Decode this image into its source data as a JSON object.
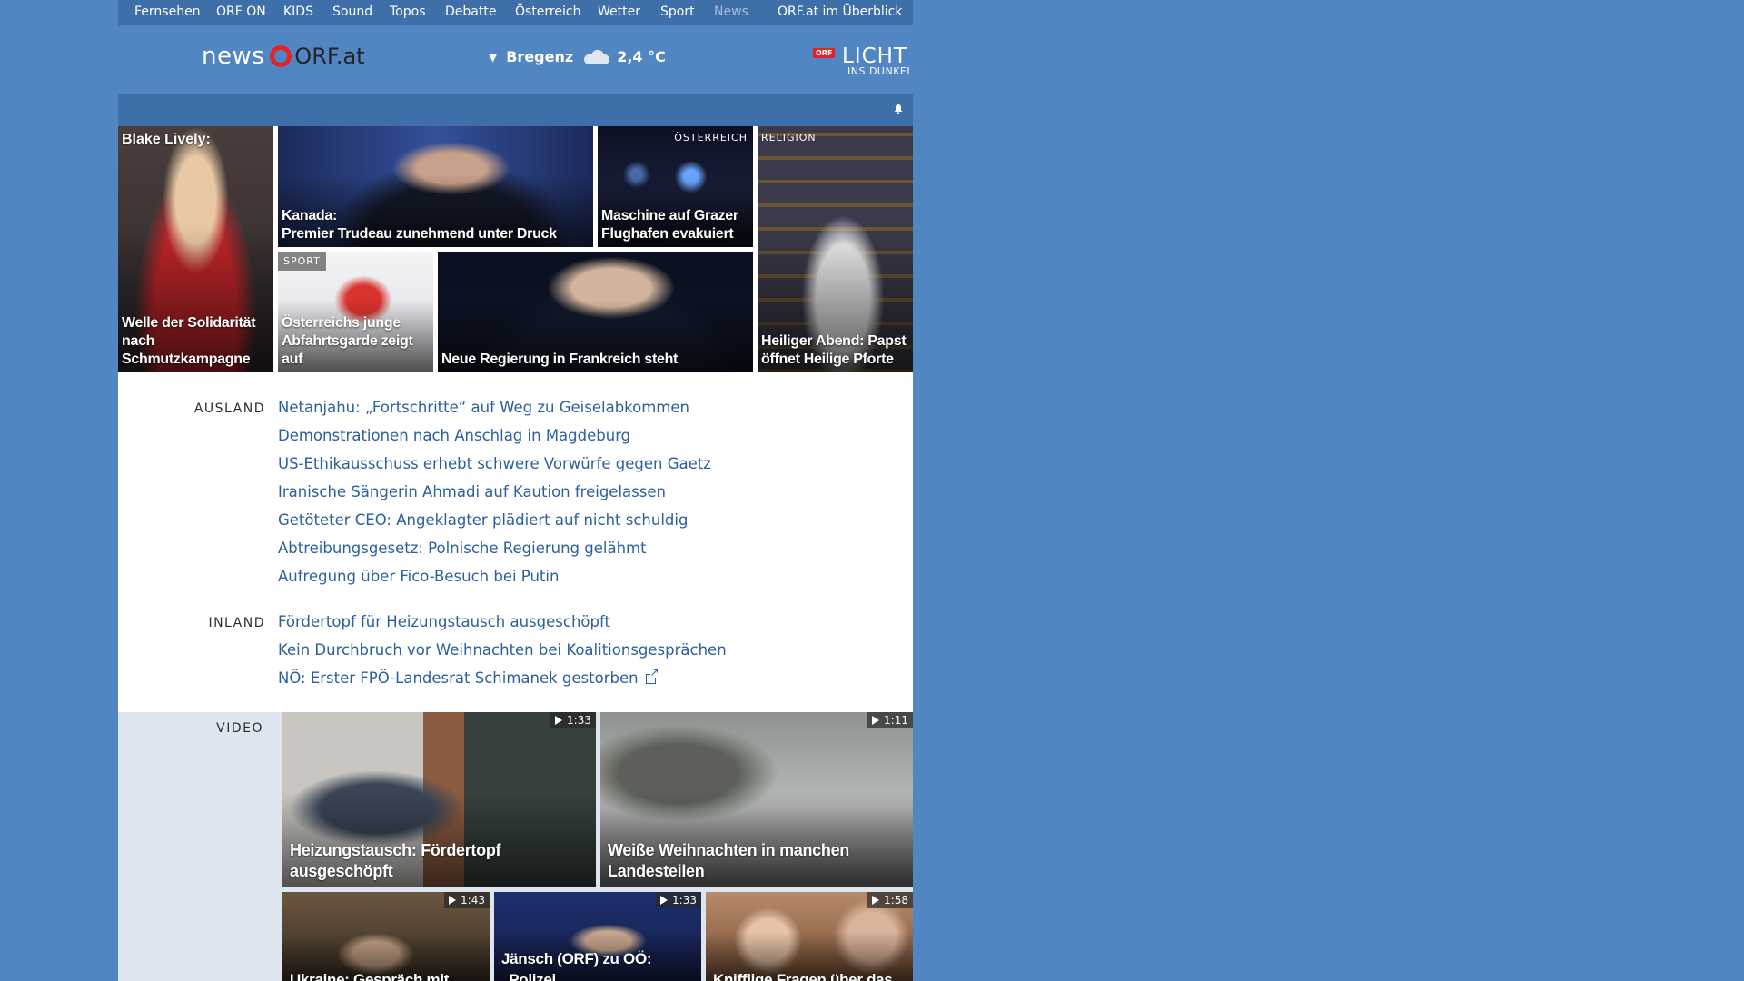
{
  "topnav": {
    "items": [
      "Fernsehen",
      "ORF ON",
      "KIDS",
      "Sound",
      "Topos",
      "Debatte",
      "Österreich",
      "Wetter",
      "Sport",
      "News"
    ],
    "overview": "ORF.at im Überblick"
  },
  "header": {
    "logo_news": "news",
    "logo_orf": "ORF.at",
    "weather_city": "Bregenz",
    "weather_temp": "2,4 °C",
    "weather_icon": "cloud-icon",
    "licht_badge": "ORF",
    "licht_big": "LICHT",
    "licht_small": "INS DUNKEL"
  },
  "teasers": [
    {
      "top": "Blake Lively:",
      "caption": "Welle der Solidarität nach Schmutzkampagne"
    },
    {
      "caption_line1": "Kanada:",
      "caption_line2": "Premier Trudeau zunehmend unter Druck"
    },
    {
      "label": "ÖSTERREICH",
      "caption": "Maschine auf Grazer Flughafen evakuiert"
    },
    {
      "label": "RELIGION",
      "caption": "Heiliger Abend: Papst öffnet Heilige Pforte"
    },
    {
      "label": "SPORT",
      "caption": "Österreichs junge Abfahrtsgarde zeigt auf"
    },
    {
      "caption": "Neue Regierung in Frankreich steht"
    }
  ],
  "ausland": {
    "title": "AUSLAND",
    "links": [
      "Netanjahu: „Fortschritte“ auf Weg zu Geiselabkommen",
      "Demonstrationen nach Anschlag in Magdeburg",
      "US-Ethikausschuss erhebt schwere Vorwürfe gegen Gaetz",
      "Iranische Sängerin Ahmadi auf Kaution freigelassen",
      "Getöteter CEO: Angeklagter plädiert auf nicht schuldig",
      "Abtreibungsgesetz: Polnische Regierung gelähmt",
      "Aufregung über Fico-Besuch bei Putin"
    ]
  },
  "inland": {
    "title": "INLAND",
    "links": [
      "Fördertopf für Heizungstausch ausgeschöpft",
      "Kein Durchbruch vor Weihnachten bei Koalitionsgesprächen",
      "NÖ: Erster FPÖ-Landesrat Schimanek gestorben"
    ]
  },
  "video": {
    "title": "VIDEO",
    "items": [
      {
        "caption": "Heizungstausch: Fördertopf ausgeschöpft",
        "duration": "1:33"
      },
      {
        "caption": "Weiße Weihnachten in manchen Landesteilen",
        "duration": "1:11"
      },
      {
        "caption": "Ukraine: Gespräch mit",
        "duration": "1:43"
      },
      {
        "caption": "Jänsch (ORF) zu OÖ: „Polizei",
        "duration": "1:33"
      },
      {
        "caption": "Knifflige Fragen über das",
        "duration": "1:58"
      }
    ]
  }
}
